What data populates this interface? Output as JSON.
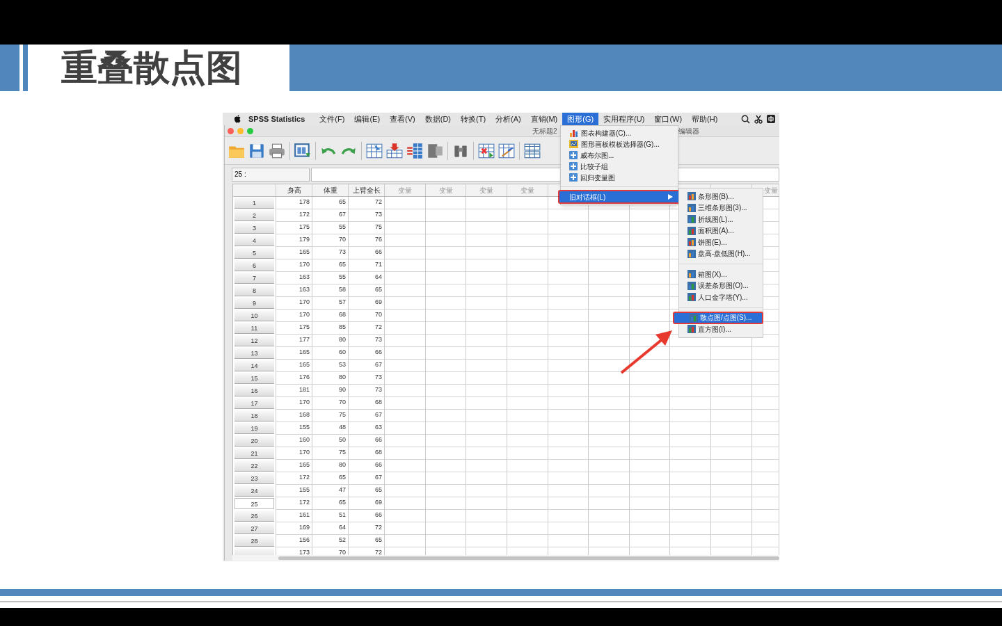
{
  "slide": {
    "title": "重叠散点图"
  },
  "menu_bar": {
    "app_name": "SPSS Statistics",
    "items": [
      {
        "label": "文件(F)",
        "selected": false
      },
      {
        "label": "编辑(E)",
        "selected": false
      },
      {
        "label": "查看(V)",
        "selected": false
      },
      {
        "label": "数据(D)",
        "selected": false
      },
      {
        "label": "转换(T)",
        "selected": false
      },
      {
        "label": "分析(A)",
        "selected": false
      },
      {
        "label": "直销(M)",
        "selected": false
      },
      {
        "label": "图形(G)",
        "selected": true
      },
      {
        "label": "实用程序(U)",
        "selected": false
      },
      {
        "label": "窗口(W)",
        "selected": false
      },
      {
        "label": "帮助(H)",
        "selected": false
      }
    ]
  },
  "window": {
    "title": "无标题2",
    "title_tail": "编辑器"
  },
  "cell_editor": {
    "cell_ref": "25 :"
  },
  "grid": {
    "columns": [
      "身高",
      "体重",
      "上臂全长",
      "变量",
      "变量",
      "变量",
      "变量",
      "变量"
    ],
    "rows": [
      {
        "label": "1",
        "selected": false,
        "values": [
          "178",
          "65",
          "72"
        ]
      },
      {
        "label": "2",
        "selected": false,
        "values": [
          "172",
          "67",
          "73"
        ]
      },
      {
        "label": "3",
        "selected": false,
        "values": [
          "175",
          "55",
          "75"
        ]
      },
      {
        "label": "4",
        "selected": false,
        "values": [
          "179",
          "70",
          "76"
        ]
      },
      {
        "label": "5",
        "selected": false,
        "values": [
          "165",
          "73",
          "66"
        ]
      },
      {
        "label": "6",
        "selected": false,
        "values": [
          "170",
          "65",
          "71"
        ]
      },
      {
        "label": "7",
        "selected": false,
        "values": [
          "163",
          "55",
          "64"
        ]
      },
      {
        "label": "8",
        "selected": false,
        "values": [
          "163",
          "58",
          "65"
        ]
      },
      {
        "label": "9",
        "selected": false,
        "values": [
          "170",
          "57",
          "69"
        ]
      },
      {
        "label": "10",
        "selected": false,
        "values": [
          "170",
          "68",
          "70"
        ]
      },
      {
        "label": "11",
        "selected": false,
        "values": [
          "175",
          "85",
          "72"
        ]
      },
      {
        "label": "12",
        "selected": false,
        "values": [
          "177",
          "80",
          "73"
        ]
      },
      {
        "label": "13",
        "selected": false,
        "values": [
          "165",
          "60",
          "66"
        ]
      },
      {
        "label": "14",
        "selected": false,
        "values": [
          "165",
          "53",
          "67"
        ]
      },
      {
        "label": "15",
        "selected": false,
        "values": [
          "176",
          "80",
          "73"
        ]
      },
      {
        "label": "16",
        "selected": false,
        "values": [
          "181",
          "90",
          "73"
        ]
      },
      {
        "label": "17",
        "selected": false,
        "values": [
          "170",
          "70",
          "68"
        ]
      },
      {
        "label": "18",
        "selected": false,
        "values": [
          "168",
          "75",
          "67"
        ]
      },
      {
        "label": "19",
        "selected": false,
        "values": [
          "155",
          "48",
          "63"
        ]
      },
      {
        "label": "20",
        "selected": false,
        "values": [
          "160",
          "50",
          "66"
        ]
      },
      {
        "label": "21",
        "selected": false,
        "values": [
          "170",
          "75",
          "68"
        ]
      },
      {
        "label": "22",
        "selected": false,
        "values": [
          "165",
          "80",
          "66"
        ]
      },
      {
        "label": "23",
        "selected": false,
        "values": [
          "172",
          "65",
          "67"
        ]
      },
      {
        "label": "24",
        "selected": false,
        "values": [
          "155",
          "47",
          "65"
        ]
      },
      {
        "label": "25",
        "selected": true,
        "values": [
          "172",
          "65",
          "69"
        ]
      },
      {
        "label": "26",
        "selected": false,
        "values": [
          "161",
          "51",
          "66"
        ]
      },
      {
        "label": "27",
        "selected": false,
        "values": [
          "169",
          "64",
          "72"
        ]
      },
      {
        "label": "28",
        "selected": false,
        "values": [
          "156",
          "52",
          "65"
        ]
      },
      {
        "selected": false,
        "values": [
          "173",
          "70",
          "72"
        ]
      }
    ]
  },
  "graphs_menu": {
    "groups": [
      [
        {
          "label": "图表构建器(C)...",
          "kind": "builder",
          "selected": false
        },
        {
          "label": "图形画板模板选择器(G)...",
          "kind": "board",
          "selected": false
        },
        {
          "label": "威布尔图...",
          "kind": "plus",
          "selected": false
        },
        {
          "label": "比较子组",
          "kind": "plus",
          "selected": false
        },
        {
          "label": "回归变量图",
          "kind": "plus",
          "selected": false
        }
      ],
      [
        {
          "label": "旧对话框(L)",
          "kind": "submenu",
          "selected": true
        }
      ]
    ]
  },
  "legacy_menu": {
    "groups": [
      [
        {
          "label": "条形图(B)...",
          "selected": false
        },
        {
          "label": "三维条形图(3)...",
          "selected": false
        },
        {
          "label": "折线图(L)...",
          "selected": false
        },
        {
          "label": "面积图(A)...",
          "selected": false
        },
        {
          "label": "饼图(E)...",
          "selected": false
        },
        {
          "label": "盘高-盘低图(H)...",
          "selected": false
        }
      ],
      [
        {
          "label": "箱图(X)...",
          "selected": false
        },
        {
          "label": "误差条形图(O)...",
          "selected": false
        },
        {
          "label": "人口金字塔(Y)...",
          "selected": false
        }
      ],
      [
        {
          "label": "散点图/点图(S)...",
          "selected": true
        },
        {
          "label": "直方图(I)...",
          "selected": false
        }
      ]
    ]
  }
}
